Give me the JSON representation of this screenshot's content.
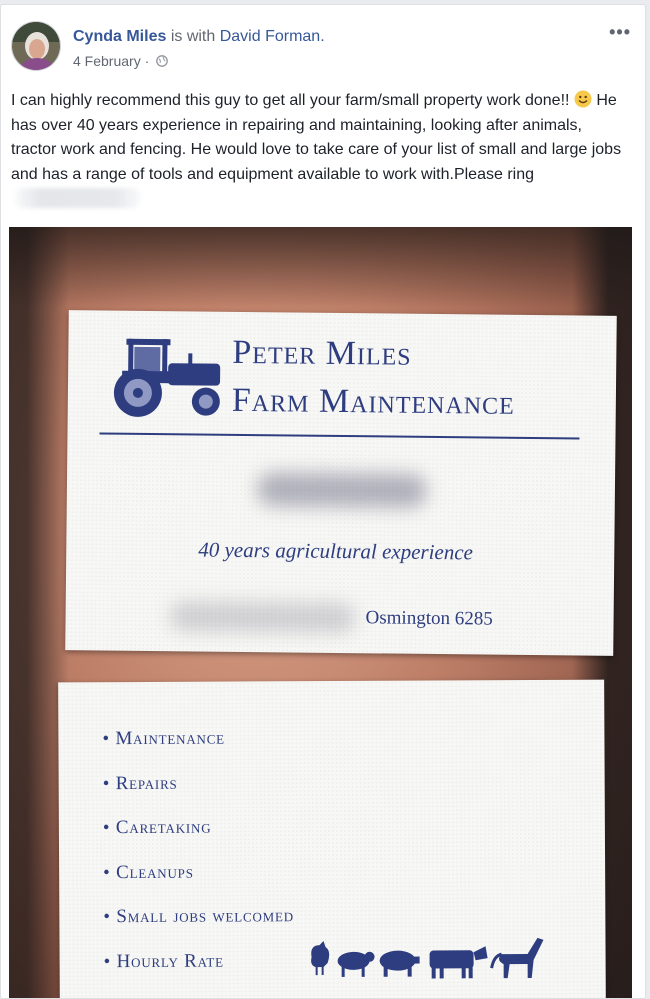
{
  "post": {
    "author": "Cynda Miles",
    "with_text": "is with",
    "tagged": "David Forman.",
    "date": "4 February",
    "separator": "·",
    "more": "•••",
    "text_part1": "I can highly recommend this guy to get all your farm/small property work done!! ",
    "text_part2": " He has over 40 years experience in repairing and maintaining, looking after animals, tractor work and fencing. He would love to take care of your list of small and large jobs and has a range of tools and equipment available to work with.Please ring"
  },
  "card_front": {
    "title_line1": "Peter Miles",
    "title_line2": "Farm Maintenance",
    "tagline": "40 years agricultural experience",
    "location": "Osmington 6285"
  },
  "card_back": {
    "services": [
      "Maintenance",
      "Repairs",
      "Caretaking",
      "Cleanups",
      "Small jobs welcomed",
      "Hourly Rate"
    ]
  },
  "colors": {
    "link": "#365899",
    "card_ink": "#2e3d7f",
    "emoji": "#f7c84a"
  }
}
